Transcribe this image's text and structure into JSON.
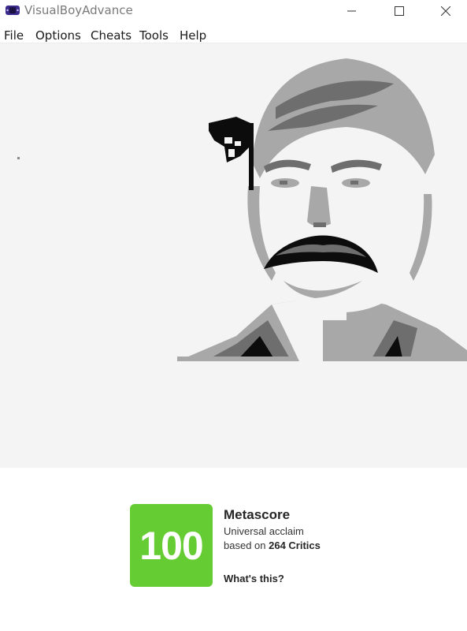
{
  "window": {
    "title": "VisualBoyAdvance",
    "app_icon": "gameboy-advance-icon",
    "controls": [
      "minimize-icon",
      "maximize-icon",
      "close-icon"
    ]
  },
  "menu": {
    "items": [
      {
        "label": "File"
      },
      {
        "label": "Options"
      },
      {
        "label": "Cheats"
      },
      {
        "label": "Tools"
      },
      {
        "label": "Help"
      }
    ]
  },
  "game_screen": {
    "palette": [
      "#f4f4f4",
      "#a8a8a8",
      "#6e6e6e",
      "#0c0c0c"
    ]
  },
  "metascore": {
    "score": "100",
    "title": "Metascore",
    "verdict": "Universal acclaim",
    "based_on_prefix": "based on ",
    "critics_count": "264 Critics",
    "link": "What's this?",
    "score_color": "#66cc33"
  }
}
